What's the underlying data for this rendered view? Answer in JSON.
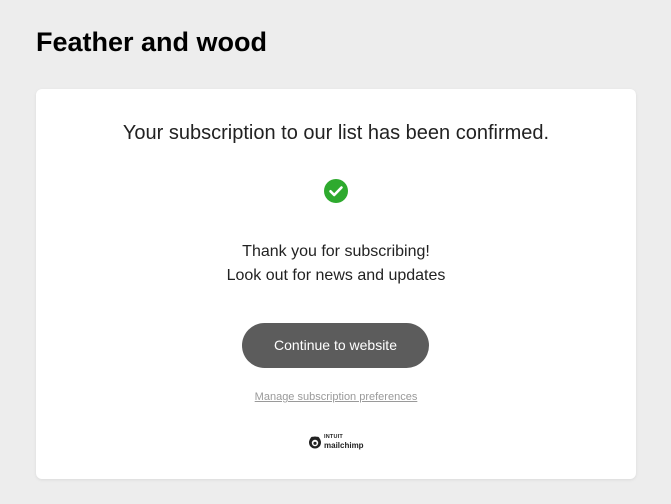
{
  "header": {
    "title": "Feather and wood"
  },
  "card": {
    "heading": "Your subscription to our list has been confirmed.",
    "status_icon": "check-circle-icon",
    "status_color": "#2eaa2e",
    "thank_you_line": "Thank you for subscribing!",
    "updates_line": "Look out for news and updates",
    "continue_button_label": "Continue to website",
    "continue_button_color": "#5c5c5c",
    "manage_link_label": "Manage subscription preferences"
  },
  "footer": {
    "brand_top": "INTUIT",
    "brand_name": "mailchimp",
    "brand_icon": "mailchimp-logo-icon"
  }
}
